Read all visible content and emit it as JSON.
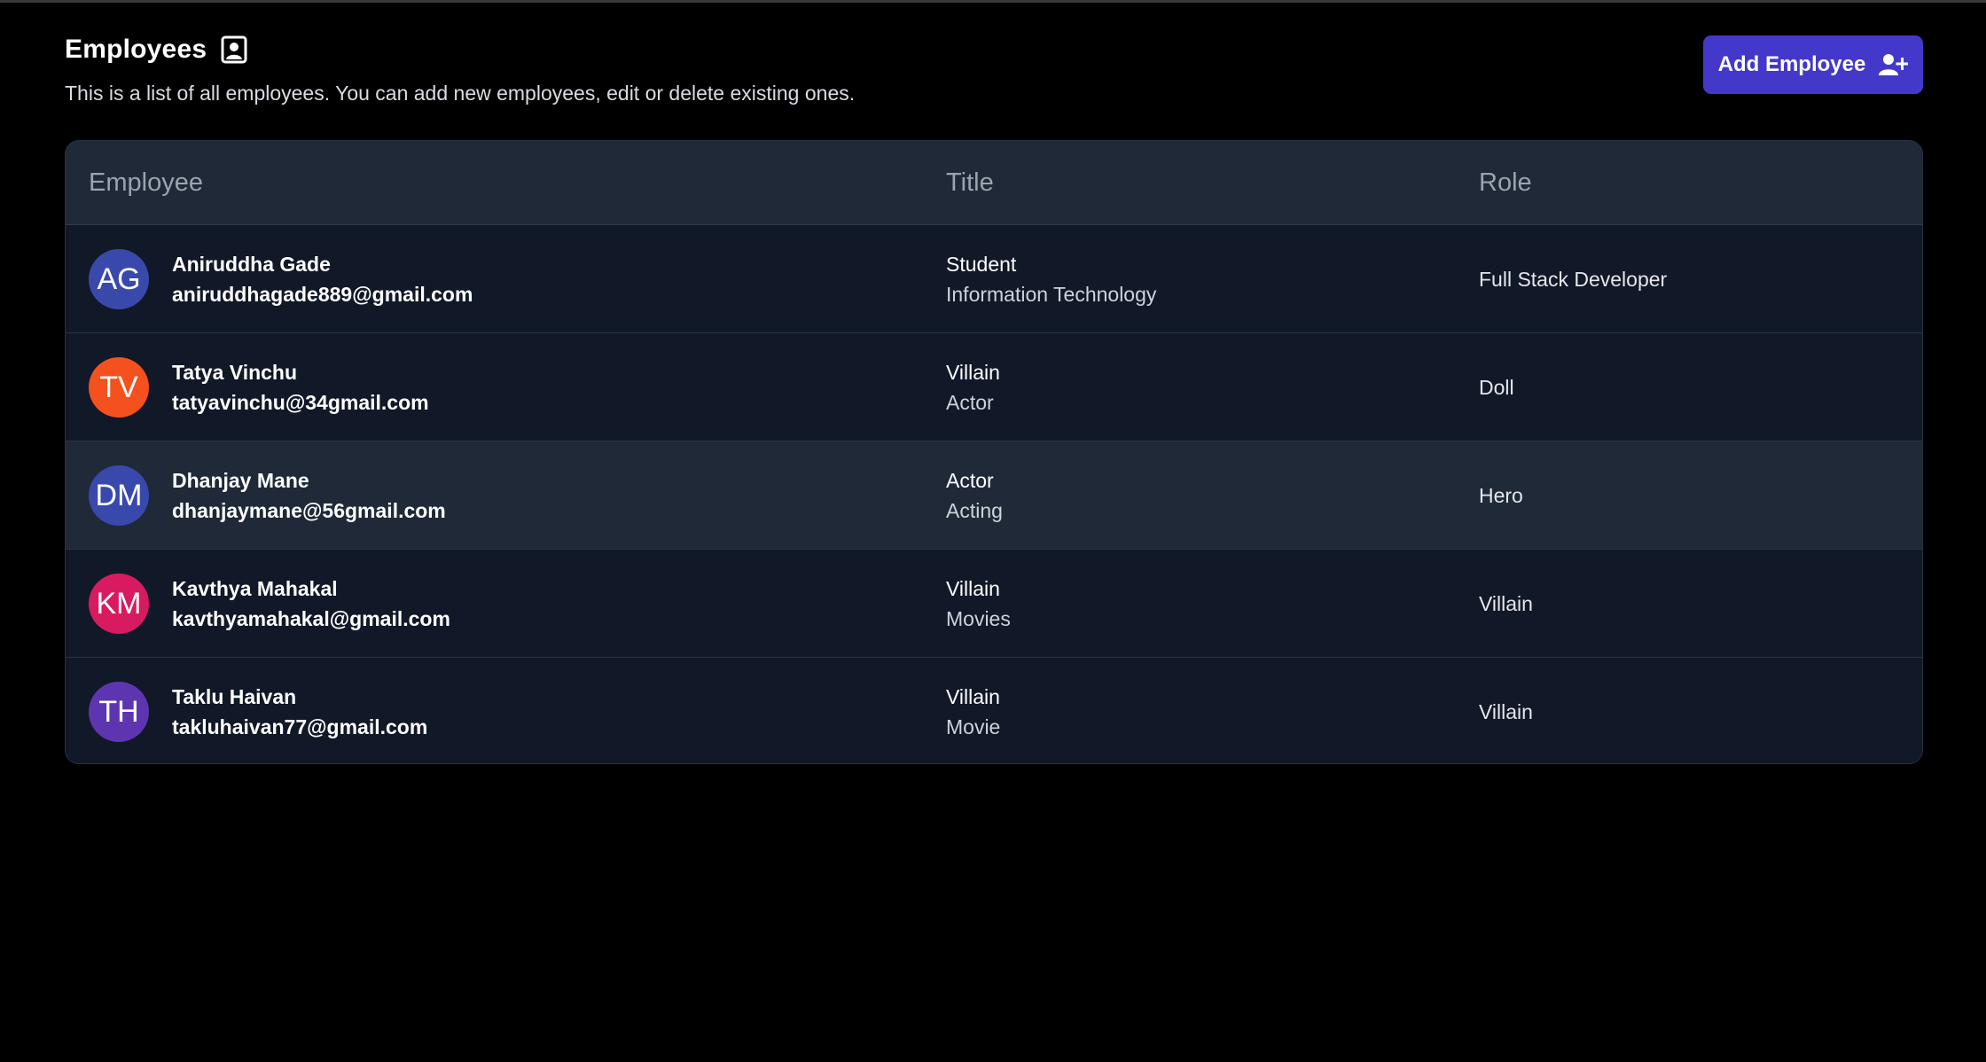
{
  "header": {
    "title": "Employees",
    "title_icon": "contact-card-icon",
    "subtitle": "This is a list of all employees. You can add new employees, edit or delete existing ones.",
    "add_button_label": "Add Employee",
    "add_button_icon": "user-plus-icon",
    "accent_color": "#4338ca"
  },
  "table": {
    "columns": [
      "Employee",
      "Title",
      "Role"
    ],
    "rows": [
      {
        "initials": "AG",
        "avatar_color": "#3949ab",
        "name": "Aniruddha Gade",
        "email": "aniruddhagade889@gmail.com",
        "title": "Student",
        "department": "Information Technology",
        "role": "Full Stack Developer"
      },
      {
        "initials": "TV",
        "avatar_color": "#f4511e",
        "name": "Tatya Vinchu",
        "email": "tatyavinchu@34gmail.com",
        "title": "Villain",
        "department": "Actor",
        "role": "Doll"
      },
      {
        "initials": "DM",
        "avatar_color": "#3949ab",
        "name": "Dhanjay Mane",
        "email": "dhanjaymane@56gmail.com",
        "title": "Actor",
        "department": "Acting",
        "role": "Hero"
      },
      {
        "initials": "KM",
        "avatar_color": "#d81b60",
        "name": "Kavthya Mahakal",
        "email": "kavthyamahakal@gmail.com",
        "title": "Villain",
        "department": "Movies",
        "role": "Villain"
      },
      {
        "initials": "TH",
        "avatar_color": "#5e35b1",
        "name": "Taklu Haivan",
        "email": "takluhaivan77@gmail.com",
        "title": "Villain",
        "department": "Movie",
        "role": "Villain"
      }
    ]
  }
}
